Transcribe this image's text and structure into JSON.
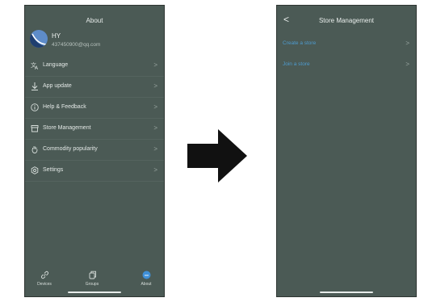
{
  "left_screen": {
    "title": "About",
    "profile": {
      "name": "HY",
      "email": "437450900@qq.com"
    },
    "menu": [
      {
        "label": "Language",
        "icon": "translate-icon"
      },
      {
        "label": "App update",
        "icon": "download-icon"
      },
      {
        "label": "Help & Feedback",
        "icon": "info-icon"
      },
      {
        "label": "Store Management",
        "icon": "store-icon"
      },
      {
        "label": "Commodity popularity",
        "icon": "hand-icon"
      },
      {
        "label": "Settings",
        "icon": "gear-icon"
      }
    ],
    "chevron": ">",
    "tabs": [
      {
        "label": "Devices",
        "icon": "link-icon"
      },
      {
        "label": "Groups",
        "icon": "copy-icon"
      },
      {
        "label": "About",
        "icon": "about-icon"
      }
    ]
  },
  "right_screen": {
    "title": "Store Management",
    "back": "<",
    "items": [
      {
        "label": "Create a store"
      },
      {
        "label": "Join a store"
      }
    ],
    "chevron": ">"
  },
  "colors": {
    "screen_bg": "#4b5a55",
    "link_blue": "#4e9bcf",
    "active_tab": "#3f8fd6",
    "arrow": "#111111"
  }
}
